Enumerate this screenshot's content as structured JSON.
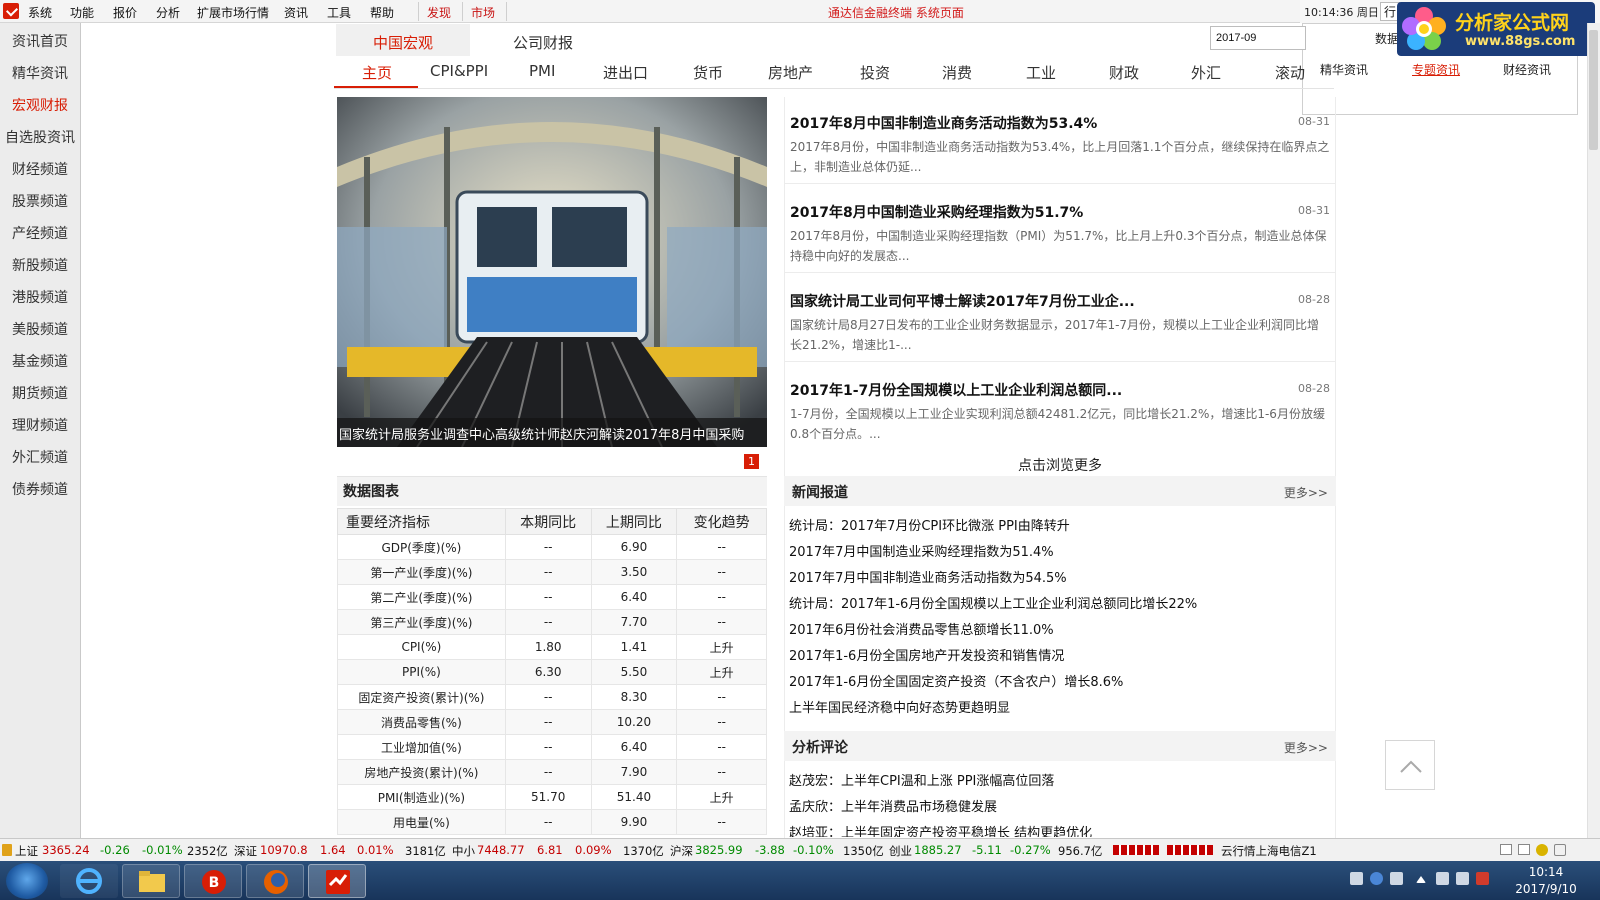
{
  "menubar": {
    "items": [
      "系统",
      "功能",
      "报价",
      "分析",
      "扩展市场行情",
      "资讯",
      "工具",
      "帮助"
    ],
    "red_items": [
      "发现",
      "市场"
    ],
    "window_title": "通达信金融终端 系统页面",
    "clock": "10:14:36 周日",
    "quote_button": "行"
  },
  "brand": {
    "name": "分析家公式网",
    "url": "www.88gs.com"
  },
  "sidebar": {
    "items": [
      "资讯首页",
      "精华资讯",
      "宏观财报",
      "自选股资讯",
      "财经频道",
      "股票频道",
      "产经频道",
      "新股频道",
      "港股频道",
      "美股频道",
      "基金频道",
      "期货频道",
      "理财频道",
      "外汇频道",
      "债券频道"
    ],
    "active_index": 2
  },
  "top_tabs": [
    "中国宏观",
    "公司财报"
  ],
  "date_input": "2017-09",
  "sub_tabs": [
    "主页",
    "CPI&PPI",
    "PMI",
    "进出口",
    "货币",
    "房地产",
    "投资",
    "消费",
    "工业",
    "财政",
    "外汇",
    "滚动"
  ],
  "popup": {
    "label": "数据播",
    "tabs": [
      "精华资讯",
      "专题资讯",
      "财经资讯"
    ],
    "active_index": 1
  },
  "photo": {
    "caption": "国家统计局服务业调查中心高级统计师赵庆河解读2017年8月中国采购",
    "slide": "1"
  },
  "data_table": {
    "title": "数据图表",
    "headers": [
      "重要经济指标",
      "本期同比",
      "上期同比",
      "变化趋势"
    ],
    "rows": [
      [
        "GDP(季度)(%)",
        "--",
        "6.90",
        "--"
      ],
      [
        "第一产业(季度)(%)",
        "--",
        "3.50",
        "--"
      ],
      [
        "第二产业(季度)(%)",
        "--",
        "6.40",
        "--"
      ],
      [
        "第三产业(季度)(%)",
        "--",
        "7.70",
        "--"
      ],
      [
        "CPI(%)",
        "1.80",
        "1.41",
        "上升"
      ],
      [
        "PPI(%)",
        "6.30",
        "5.50",
        "上升"
      ],
      [
        "固定资产投资(累计)(%)",
        "--",
        "8.30",
        "--"
      ],
      [
        "消费品零售(%)",
        "--",
        "10.20",
        "--"
      ],
      [
        "工业增加值(%)",
        "--",
        "6.40",
        "--"
      ],
      [
        "房地产投资(累计)(%)",
        "--",
        "7.90",
        "--"
      ],
      [
        "PMI(制造业)(%)",
        "51.70",
        "51.40",
        "上升"
      ],
      [
        "用电量(%)",
        "--",
        "9.90",
        "--"
      ]
    ]
  },
  "featured_news": [
    {
      "title": "2017年8月中国非制造业商务活动指数为53.4%",
      "date": "08-31",
      "summary": "2017年8月份，中国非制造业商务活动指数为53.4%，比上月回落1.1个百分点，继续保持在临界点之上，非制造业总体仍延..."
    },
    {
      "title": "2017年8月中国制造业采购经理指数为51.7%",
      "date": "08-31",
      "summary": "2017年8月份，中国制造业采购经理指数（PMI）为51.7%，比上月上升0.3个百分点，制造业总体保持稳中向好的发展态..."
    },
    {
      "title": "国家统计局工业司何平博士解读2017年7月份工业企...",
      "date": "08-28",
      "summary": "国家统计局8月27日发布的工业企业财务数据显示，2017年1-7月份，规模以上工业企业利润同比增长21.2%，增速比1-..."
    },
    {
      "title": "2017年1-7月份全国规模以上工业企业利润总额同...",
      "date": "08-28",
      "summary": "1-7月份，全国规模以上工业企业实现利润总额42481.2亿元，同比增长21.2%，增速比1-6月份放缓0.8个百分点。..."
    }
  ],
  "more_link": "点击浏览更多",
  "news_section": {
    "title": "新闻报道",
    "more": "更多>>",
    "items": [
      "统计局：2017年7月份CPI环比微涨 PPI由降转升",
      "2017年7月中国制造业采购经理指数为51.4%",
      "2017年7月中国非制造业商务活动指数为54.5%",
      "统计局：2017年1-6月份全国规模以上工业企业利润总额同比增长22%",
      "2017年6月份社会消费品零售总额增长11.0%",
      "2017年1-6月份全国房地产开发投资和销售情况",
      "2017年1-6月份全国固定资产投资（不含农户）增长8.6%",
      "上半年国民经济稳中向好态势更趋明显"
    ]
  },
  "analysis_section": {
    "title": "分析评论",
    "more": "更多>>",
    "items": [
      "赵茂宏：上半年CPI温和上涨 PPI涨幅高位回落",
      "孟庆欣：上半年消费品市场稳健发展",
      "赵培亚：上半年固定资产投资平稳增长 结构更趋优化"
    ]
  },
  "ticker": [
    {
      "name": "上证",
      "value": "3365.24",
      "change": "-0.26",
      "pct": "-0.01%",
      "amount": "2352亿"
    },
    {
      "name": "深证",
      "value": "10970.8",
      "change": "1.64",
      "pct": "0.01%",
      "amount": "3181亿"
    },
    {
      "name": "中小",
      "value": "7448.77",
      "change": "6.81",
      "pct": "0.09%",
      "amount": "1370亿"
    },
    {
      "name": "沪深",
      "value": "3825.99",
      "change": "-3.88",
      "pct": "-0.10%",
      "amount": "1350亿"
    },
    {
      "name": "创业",
      "value": "1885.27",
      "change": "-5.11",
      "pct": "-0.27%",
      "amount": "956.7亿"
    }
  ],
  "isp_label": "云行情上海电信Z1",
  "taskbar": {
    "time": "10:14",
    "date": "2017/9/10"
  },
  "colors": {
    "accent": "#d81e06",
    "up": "#c40000",
    "down": "#008a00"
  }
}
